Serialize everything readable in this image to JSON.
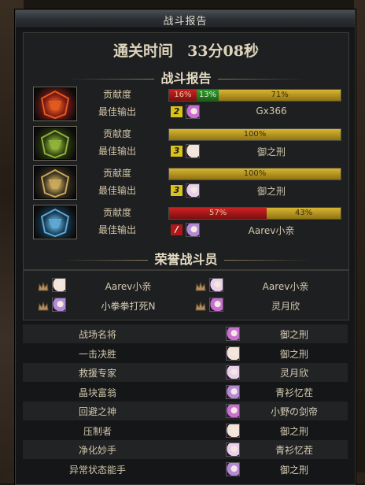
{
  "window": {
    "title": "战斗报告"
  },
  "clear_time": {
    "label": "通关时间",
    "value": "33分08秒"
  },
  "battle_report": {
    "heading": "战斗报告",
    "contribution_label": "贡献度",
    "best_output_label": "最佳输出",
    "players": [
      {
        "segments": [
          {
            "text": "16%",
            "color": "red",
            "share": 0.16
          },
          {
            "text": "13%",
            "color": "green",
            "share": 0.13
          },
          {
            "text": "71%",
            "color": "gold",
            "share": 0.71
          }
        ],
        "rank": "2",
        "best_name": "Gx366",
        "portrait_colors": [
          "#7a1a14",
          "#e25a1e"
        ]
      },
      {
        "segments": [
          {
            "text": "100%",
            "color": "gold",
            "share": 1.0
          }
        ],
        "rank": "3",
        "best_name": "御之刑",
        "portrait_colors": [
          "#2d3d12",
          "#8eb23a"
        ]
      },
      {
        "segments": [
          {
            "text": "100%",
            "color": "gold",
            "share": 1.0
          }
        ],
        "rank": "3",
        "best_name": "御之刑",
        "portrait_colors": [
          "#3a3322",
          "#c8a85a"
        ]
      },
      {
        "segments": [
          {
            "text": "57%",
            "color": "red",
            "share": 0.57
          },
          {
            "text": "43%",
            "color": "gold",
            "share": 0.43
          }
        ],
        "rank": "/",
        "best_name": "Aarev小亲",
        "portrait_colors": [
          "#163a52",
          "#5fa8d3"
        ]
      }
    ]
  },
  "honor": {
    "heading": "荣誉战斗员",
    "members": [
      "Aarev小亲",
      "Aarev小亲",
      "小拳拳打死N",
      "灵月欣"
    ]
  },
  "awards": [
    {
      "title": "战场名将",
      "player": "御之刑"
    },
    {
      "title": "一击决胜",
      "player": "御之刑"
    },
    {
      "title": "救援专家",
      "player": "灵月欣"
    },
    {
      "title": "晶块富翁",
      "player": "青衫忆茬"
    },
    {
      "title": "回避之神",
      "player": "小野の剑帝"
    },
    {
      "title": "压制者",
      "player": "御之刑"
    },
    {
      "title": "净化妙手",
      "player": "青衫忆茬"
    },
    {
      "title": "异常状态能手",
      "player": "御之刑"
    }
  ]
}
